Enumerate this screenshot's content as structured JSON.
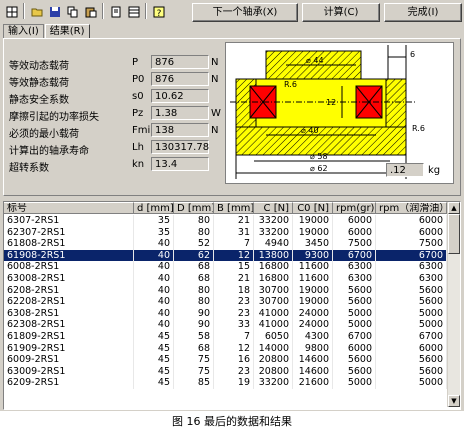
{
  "toolbar": {
    "icons": [
      "grid-icon",
      "open-folder-icon",
      "save-icon",
      "copy-icon",
      "paste-icon",
      "print-icon",
      "export-icon",
      "help-icon"
    ]
  },
  "buttons": {
    "next": "下一个轴承(X)",
    "calc": "计算(C)",
    "done": "完成(I)"
  },
  "tabs": [
    {
      "label": "输入(I)",
      "active": false
    },
    {
      "label": "结果(R)",
      "active": true
    }
  ],
  "results": [
    {
      "label": "等效动态载荷",
      "symbol": "P",
      "value": "876",
      "unit": "N"
    },
    {
      "label": "等效静态载荷",
      "symbol": "P0",
      "value": "876",
      "unit": "N"
    },
    {
      "label": "静态安全系数",
      "symbol": "s0",
      "value": "10.62",
      "unit": ""
    },
    {
      "label": "摩擦引起的功率损失",
      "symbol": "Pz",
      "value": "1.38",
      "unit": "W"
    },
    {
      "label": "必须的最小载荷",
      "symbol": "Fmin",
      "value": "138",
      "unit": "N"
    },
    {
      "label": "计算出的轴承寿命",
      "symbol": "Lh",
      "value": "130317.78",
      "unit": ""
    },
    {
      "label": "超转系数",
      "symbol": "kn",
      "value": "13.4",
      "unit": ""
    }
  ],
  "drawing": {
    "dim_shaft": "⌀ 44",
    "dim_width": "6",
    "dim_radius_top": "R.6",
    "dim_height": "12",
    "dim_bore": "⌀ 40",
    "dim_radius_right": "R.6",
    "dim_outer_housing": "⌀ 58",
    "dim_outer": "⌀ 62",
    "weight_value": ".12",
    "weight_unit": "kg"
  },
  "table": {
    "columns": [
      "标号",
      "d [mm]",
      "D [mm]",
      "B [mm]",
      "C [N]",
      "C0 [N]",
      "rpm(gr)",
      "rpm（润滑油）"
    ],
    "rows": [
      [
        "6307-2RS1",
        "35",
        "80",
        "21",
        "33200",
        "19000",
        "6000",
        "6000"
      ],
      [
        "62307-2RS1",
        "35",
        "80",
        "31",
        "33200",
        "19000",
        "6000",
        "6000"
      ],
      [
        "61808-2RS1",
        "40",
        "52",
        "7",
        "4940",
        "3450",
        "7500",
        "7500"
      ],
      [
        "61908-2RS1",
        "40",
        "62",
        "12",
        "13800",
        "9300",
        "6700",
        "6700"
      ],
      [
        "6008-2RS1",
        "40",
        "68",
        "15",
        "16800",
        "11600",
        "6300",
        "6300"
      ],
      [
        "63008-2RS1",
        "40",
        "68",
        "21",
        "16800",
        "11600",
        "6300",
        "6300"
      ],
      [
        "6208-2RS1",
        "40",
        "80",
        "18",
        "30700",
        "19000",
        "5600",
        "5600"
      ],
      [
        "62208-2RS1",
        "40",
        "80",
        "23",
        "30700",
        "19000",
        "5600",
        "5600"
      ],
      [
        "6308-2RS1",
        "40",
        "90",
        "23",
        "41000",
        "24000",
        "5000",
        "5000"
      ],
      [
        "62308-2RS1",
        "40",
        "90",
        "33",
        "41000",
        "24000",
        "5000",
        "5000"
      ],
      [
        "61809-2RS1",
        "45",
        "58",
        "7",
        "6050",
        "4300",
        "6700",
        "6700"
      ],
      [
        "61909-2RS1",
        "45",
        "68",
        "12",
        "14000",
        "9800",
        "6000",
        "6000"
      ],
      [
        "6009-2RS1",
        "45",
        "75",
        "16",
        "20800",
        "14600",
        "5600",
        "5600"
      ],
      [
        "63009-2RS1",
        "45",
        "75",
        "23",
        "20800",
        "14600",
        "5600",
        "5600"
      ],
      [
        "6209-2RS1",
        "45",
        "85",
        "19",
        "33200",
        "21600",
        "5000",
        "5000"
      ]
    ],
    "selected_row": 3
  },
  "caption": "图 16  最后的数据和结果"
}
